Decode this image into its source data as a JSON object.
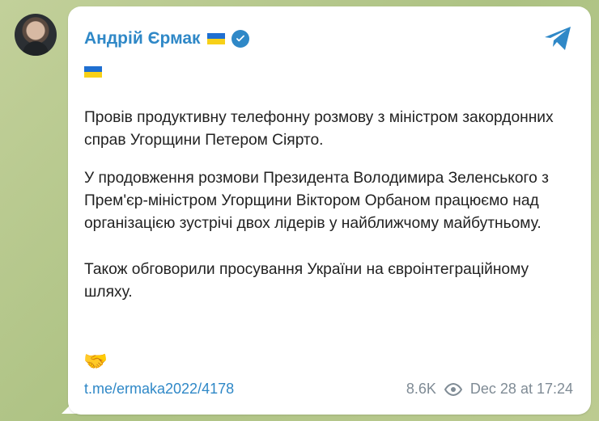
{
  "post": {
    "author_name": "Андрій Єрмак",
    "message": {
      "lines_block1": "Провів продуктивну телефонну розмову з міністром закордонних справ Угорщини Петером Сіярто.",
      "lines_block2": "У продовження розмови Президента Володимира Зеленського з Прем'єр-міністром Угорщини Віктором Орбаном працюємо над організацією зустрічі двох лідерів у найближчому майбутньому.",
      "lines_block3": "Також обговорили просування України на євроінтеграційному шляху."
    },
    "link": "t.me/ermaka2022/4178",
    "views": "8.6K",
    "date": "Dec 28 at 17:24"
  },
  "icons": {
    "share": "telegram-share-icon",
    "verified": "verified-icon",
    "views": "eye-icon",
    "handshake": "handshake-icon"
  },
  "colors": {
    "accent": "#2f88c7",
    "meta": "#7f8b95"
  }
}
